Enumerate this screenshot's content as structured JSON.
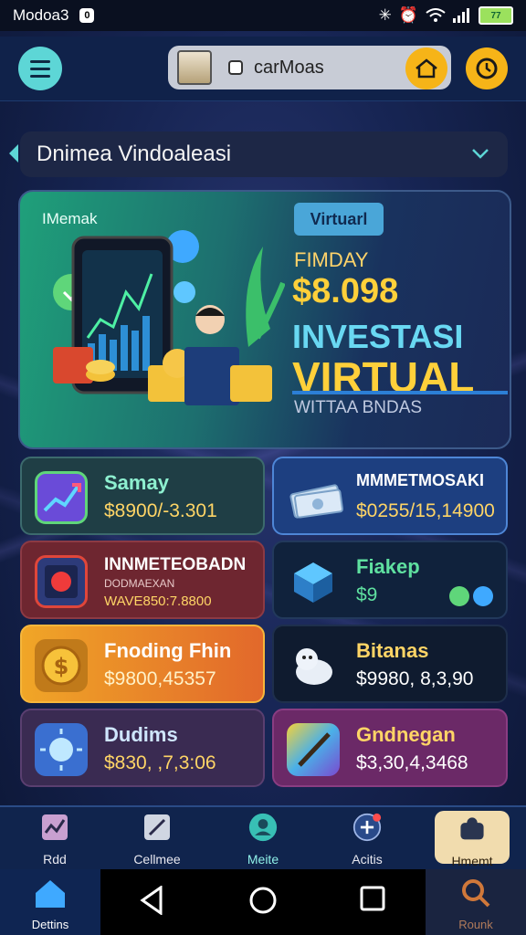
{
  "status_bar": {
    "title": "Modoa3",
    "notif": "0",
    "battery": "77"
  },
  "topbar": {
    "search_text": "carMoas"
  },
  "dropdown": {
    "label": "Dnimea Vindoaleasi"
  },
  "hero": {
    "tag": "IMemak",
    "badge": "Virtuarl",
    "pre": "FIMDAY",
    "amount": "$8.098",
    "title_1": "INVESTASI",
    "title_2": "VIRTUAL",
    "subtitle": "WITTAA BNDAS"
  },
  "cards": [
    {
      "title": "Samay",
      "value": "$8900/-3.301"
    },
    {
      "title": "MMMETMOSAKI",
      "value": "$0255/15,14900"
    },
    {
      "title": "INNMETEOBADN",
      "sub": "DODMAEXAN",
      "value": "WAVE850:7.8800"
    },
    {
      "title": "Fiakep",
      "value": "$9"
    },
    {
      "title": "Fnoding Fhin",
      "value": "$9800,45357"
    },
    {
      "title": "Bitanas",
      "value": "$9980, 8,3,90"
    },
    {
      "title": "Dudims",
      "value": "$830, ,7,3:06"
    },
    {
      "title": "Gndnegan",
      "value": "$3,30,4,3468"
    }
  ],
  "tabs": [
    {
      "label": "Rdd"
    },
    {
      "label": "Cellmee"
    },
    {
      "label": "Meite"
    },
    {
      "label": "Acitis"
    },
    {
      "label": "Hmemt"
    }
  ],
  "nav": {
    "left_label": "Dettins",
    "right_label": "Rounk"
  },
  "colors": {
    "accent_teal": "#5dd6d6",
    "accent_gold": "#f6b418",
    "hero_gold": "#ffd03a"
  }
}
